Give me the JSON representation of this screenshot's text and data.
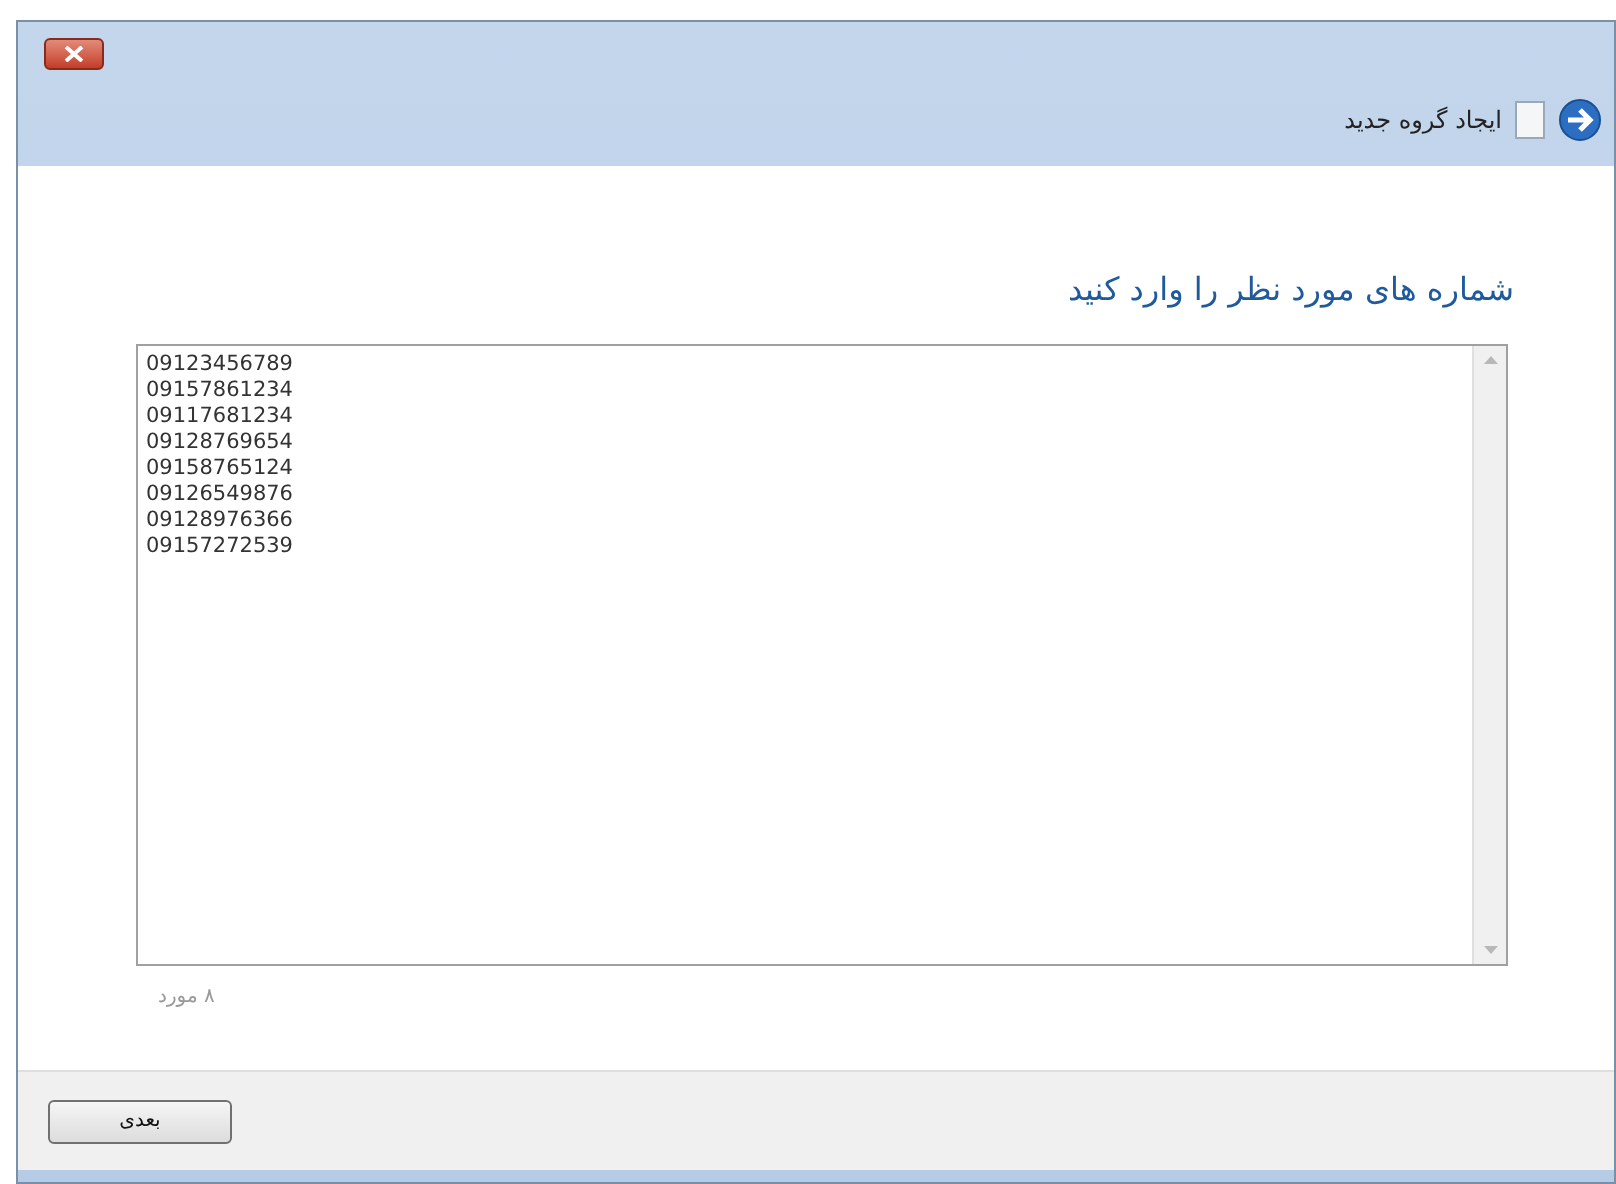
{
  "window": {
    "title": "ایجاد گروه جدید"
  },
  "instruction": "شماره های مورد نظر را وارد کنید",
  "numbers": [
    "09123456789",
    "09157861234",
    "09117681234",
    "09128769654",
    "09158765124",
    "09126549876",
    "09128976366",
    "09157272539"
  ],
  "count": "۸ مورد",
  "buttons": [
    "بعدی"
  ]
}
